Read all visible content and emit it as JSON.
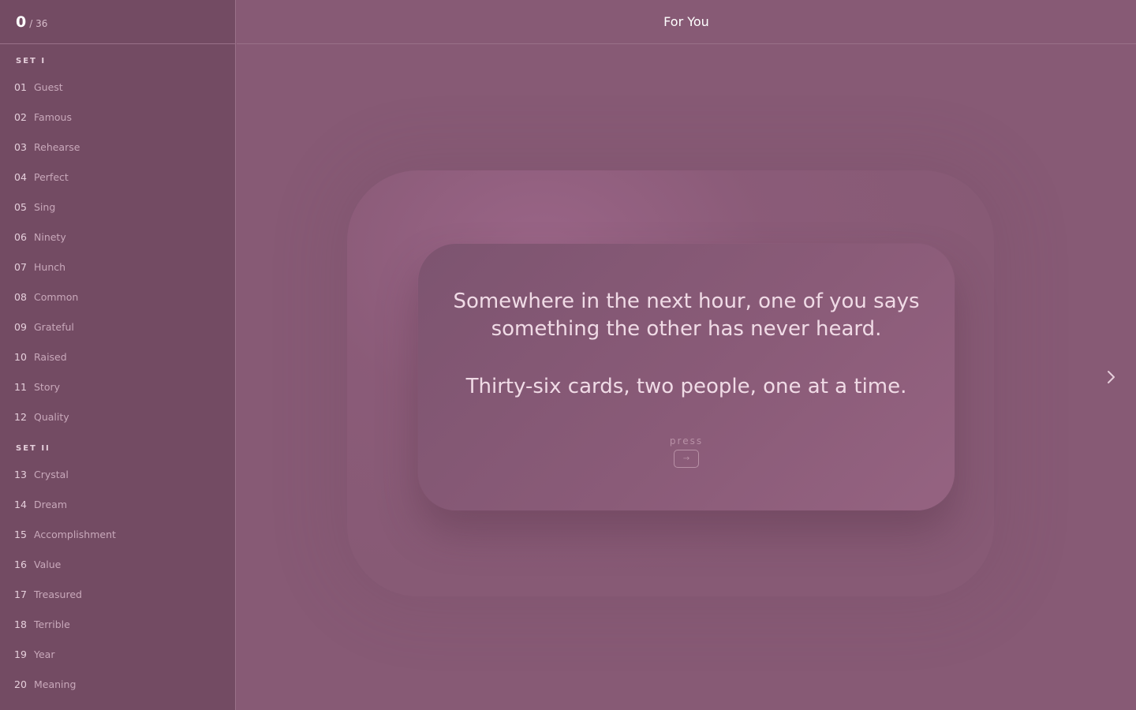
{
  "progress": {
    "current": "0",
    "total": "/ 36"
  },
  "header": {
    "title": "For You"
  },
  "sidebar": {
    "sets": [
      {
        "label": "SET I",
        "items": [
          {
            "num": "01",
            "label": "Guest"
          },
          {
            "num": "02",
            "label": "Famous"
          },
          {
            "num": "03",
            "label": "Rehearse"
          },
          {
            "num": "04",
            "label": "Perfect"
          },
          {
            "num": "05",
            "label": "Sing"
          },
          {
            "num": "06",
            "label": "Ninety"
          },
          {
            "num": "07",
            "label": "Hunch"
          },
          {
            "num": "08",
            "label": "Common"
          },
          {
            "num": "09",
            "label": "Grateful"
          },
          {
            "num": "10",
            "label": "Raised"
          },
          {
            "num": "11",
            "label": "Story"
          },
          {
            "num": "12",
            "label": "Quality"
          }
        ]
      },
      {
        "label": "SET II",
        "items": [
          {
            "num": "13",
            "label": "Crystal"
          },
          {
            "num": "14",
            "label": "Dream"
          },
          {
            "num": "15",
            "label": "Accomplishment"
          },
          {
            "num": "16",
            "label": "Value"
          },
          {
            "num": "17",
            "label": "Treasured"
          },
          {
            "num": "18",
            "label": "Terrible"
          },
          {
            "num": "19",
            "label": "Year"
          },
          {
            "num": "20",
            "label": "Meaning"
          }
        ]
      }
    ]
  },
  "card": {
    "line1": "Somewhere in the next hour, one of you says something the other has never heard.",
    "line2": "Thirty-six cards, two people, one at a time.",
    "press_label": "press",
    "key_label": "→"
  },
  "icons": {
    "next": "chevron-right-icon"
  },
  "colors": {
    "background": "#875a75",
    "sidebar": "#734b63",
    "card": "#8a5b78",
    "text": "#f0dbe6"
  }
}
